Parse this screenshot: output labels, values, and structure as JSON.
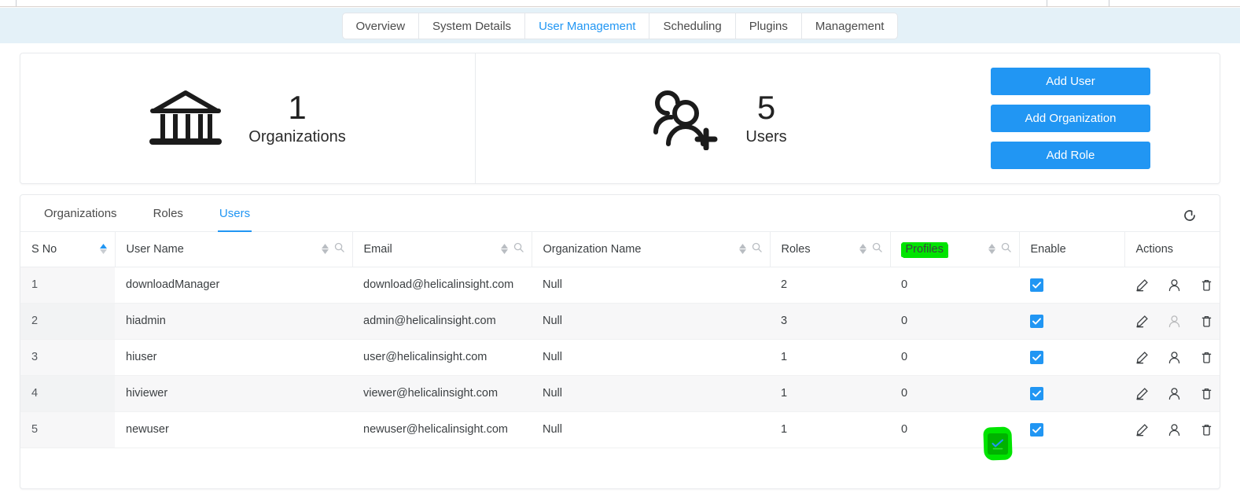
{
  "top_tabs": [
    {
      "label": "Overview",
      "active": false
    },
    {
      "label": "System Details",
      "active": false
    },
    {
      "label": "User Management",
      "active": true
    },
    {
      "label": "Scheduling",
      "active": false
    },
    {
      "label": "Plugins",
      "active": false
    },
    {
      "label": "Management",
      "active": false
    }
  ],
  "stats": {
    "organizations": {
      "count": "1",
      "label": "Organizations",
      "icon": "bank-icon"
    },
    "users": {
      "count": "5",
      "label": "Users",
      "icon": "add-users-icon"
    }
  },
  "buttons": {
    "add_user": "Add User",
    "add_organization": "Add Organization",
    "add_role": "Add Role"
  },
  "inner_tabs": [
    {
      "label": "Organizations",
      "active": false
    },
    {
      "label": "Roles",
      "active": false
    },
    {
      "label": "Users",
      "active": true
    }
  ],
  "refresh_icon": "refresh-icon",
  "table": {
    "columns": [
      {
        "key": "sno",
        "label": "S No",
        "sortable": true,
        "searchable": false,
        "highlighted": false
      },
      {
        "key": "user_name",
        "label": "User Name",
        "sortable": true,
        "searchable": true,
        "highlighted": false
      },
      {
        "key": "email",
        "label": "Email",
        "sortable": true,
        "searchable": true,
        "highlighted": false
      },
      {
        "key": "organization_name",
        "label": "Organization Name",
        "sortable": true,
        "searchable": true,
        "highlighted": false
      },
      {
        "key": "roles",
        "label": "Roles",
        "sortable": true,
        "searchable": true,
        "highlighted": false
      },
      {
        "key": "profiles",
        "label": "Profiles",
        "sortable": true,
        "searchable": true,
        "highlighted": true
      },
      {
        "key": "enable",
        "label": "Enable",
        "sortable": false,
        "searchable": false,
        "highlighted": false
      },
      {
        "key": "actions",
        "label": "Actions",
        "sortable": false,
        "searchable": false,
        "highlighted": false
      }
    ],
    "rows": [
      {
        "sno": "1",
        "user_name": "downloadManager",
        "email": "download@helicalinsight.com",
        "organization_name": "Null",
        "roles": "2",
        "profiles": "0",
        "enable": true,
        "profile_action_enabled": true
      },
      {
        "sno": "2",
        "user_name": "hiadmin",
        "email": "admin@helicalinsight.com",
        "organization_name": "Null",
        "roles": "3",
        "profiles": "0",
        "enable": true,
        "profile_action_enabled": false
      },
      {
        "sno": "3",
        "user_name": "hiuser",
        "email": "user@helicalinsight.com",
        "organization_name": "Null",
        "roles": "1",
        "profiles": "0",
        "enable": true,
        "profile_action_enabled": true
      },
      {
        "sno": "4",
        "user_name": "hiviewer",
        "email": "viewer@helicalinsight.com",
        "organization_name": "Null",
        "roles": "1",
        "profiles": "0",
        "enable": true,
        "profile_action_enabled": true
      },
      {
        "sno": "5",
        "user_name": "newuser",
        "email": "newuser@helicalinsight.com",
        "organization_name": "Null",
        "roles": "1",
        "profiles": "0",
        "enable": true,
        "profile_action_enabled": true
      }
    ],
    "row_action_icons": [
      "edit-icon",
      "user-profile-icon",
      "delete-icon"
    ]
  },
  "annotations": {
    "highlight_color": "#00e400",
    "highlighted_header": "Profiles",
    "cursor_marker": "click-marker"
  },
  "colors": {
    "accent": "#2196f3",
    "tabbar_bg": "#e4f1f8",
    "row_alt_bg": "#f7f7f8"
  }
}
